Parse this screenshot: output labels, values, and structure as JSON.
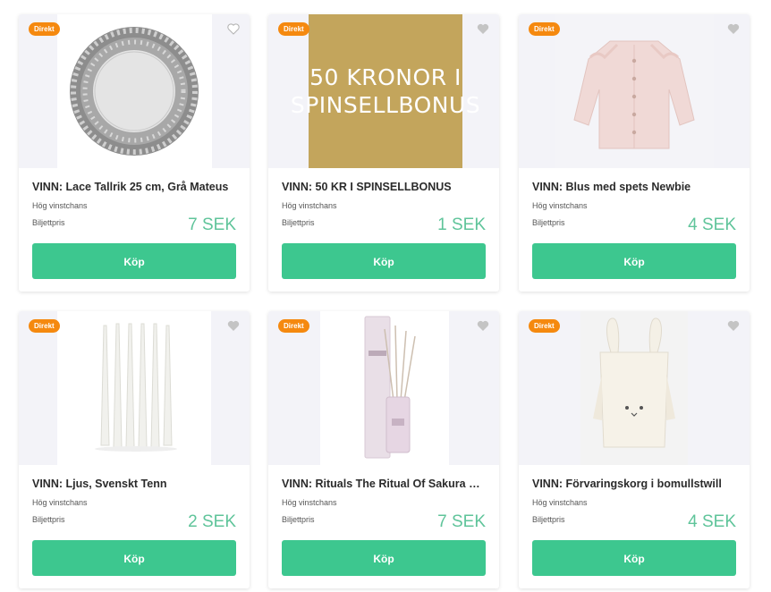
{
  "colors": {
    "badge": "#f5890f",
    "buy_button": "#3dc78f",
    "price": "#5fc49a",
    "gold_banner": "#c3a55c"
  },
  "products": [
    {
      "badge": "Direkt",
      "title": "VINN: Lace Tallrik 25 cm, Grå Mateus",
      "chance": "Hög vinstchans",
      "price_label": "Biljettpris",
      "price": "7 SEK",
      "buy_label": "Köp",
      "image": "plate"
    },
    {
      "badge": "Direkt",
      "title": "VINN: 50 KR I SPINSELLBONUS",
      "chance": "Hög vinstchans",
      "price_label": "Biljettpris",
      "price": "1 SEK",
      "buy_label": "Köp",
      "image": "bonus-banner",
      "banner_text": "50 KRONOR I SPINSELLBONUS"
    },
    {
      "badge": "Direkt",
      "title": "VINN: Blus med spets Newbie",
      "chance": "Hög vinstchans",
      "price_label": "Biljettpris",
      "price": "4 SEK",
      "buy_label": "Köp",
      "image": "blouse"
    },
    {
      "badge": "Direkt",
      "title": "VINN: Ljus, Svenskt Tenn",
      "chance": "Hög vinstchans",
      "price_label": "Biljettpris",
      "price": "2 SEK",
      "buy_label": "Köp",
      "image": "candles"
    },
    {
      "badge": "Direkt",
      "title": "VINN: Rituals The Ritual Of Sakura Fragrance Sticks",
      "chance": "Hög vinstchans",
      "price_label": "Biljettpris",
      "price": "7 SEK",
      "buy_label": "Köp",
      "image": "diffuser"
    },
    {
      "badge": "Direkt",
      "title": "VINN: Förvaringskorg i bomullstwill",
      "chance": "Hög vinstchans",
      "price_label": "Biljettpris",
      "price": "4 SEK",
      "buy_label": "Köp",
      "image": "basket"
    }
  ]
}
